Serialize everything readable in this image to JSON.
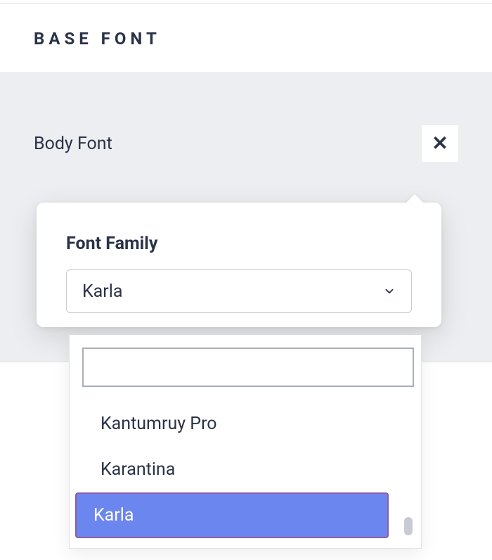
{
  "header": {
    "title": "BASE FONT"
  },
  "panel": {
    "label": "Body Font"
  },
  "popover": {
    "heading": "Font Family",
    "select": {
      "value": "Karla"
    },
    "search": {
      "value": "",
      "placeholder": ""
    },
    "options": [
      {
        "label": "Kantumruy Pro",
        "selected": false
      },
      {
        "label": "Karantina",
        "selected": false
      },
      {
        "label": "Karla",
        "selected": true
      }
    ]
  }
}
